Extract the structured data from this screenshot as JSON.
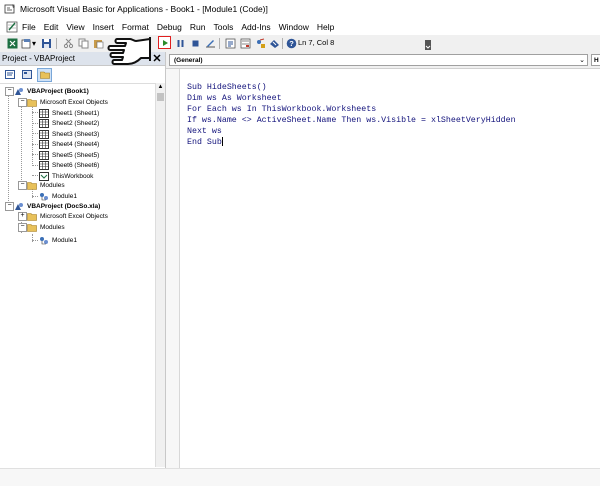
{
  "window": {
    "title": "Microsoft Visual Basic for Applications - Book1 - [Module1 (Code)]"
  },
  "menu": [
    "File",
    "Edit",
    "View",
    "Insert",
    "Format",
    "Debug",
    "Run",
    "Tools",
    "Add-Ins",
    "Window",
    "Help"
  ],
  "toolbar": {
    "status": "Ln 7, Col 8"
  },
  "project_panel": {
    "title": "Project - VBAProject",
    "close": "✕",
    "tree": [
      {
        "label": "VBAProject (Book1)",
        "bold": true,
        "icon": "vbaproject-icon"
      },
      {
        "label": "Microsoft Excel Objects",
        "icon": "folder-icon"
      },
      {
        "label": "Sheet1 (Sheet1)",
        "icon": "sheet-icon"
      },
      {
        "label": "Sheet2 (Sheet2)",
        "icon": "sheet-icon"
      },
      {
        "label": "Sheet3 (Sheet3)",
        "icon": "sheet-icon"
      },
      {
        "label": "Sheet4 (Sheet4)",
        "icon": "sheet-icon"
      },
      {
        "label": "Sheet5 (Sheet5)",
        "icon": "sheet-icon"
      },
      {
        "label": "Sheet6 (Sheet6)",
        "icon": "sheet-icon"
      },
      {
        "label": "ThisWorkbook",
        "icon": "workbook-icon"
      },
      {
        "label": "Modules",
        "icon": "folder-icon"
      },
      {
        "label": "Module1",
        "icon": "module-icon"
      },
      {
        "label": "VBAProject (DocSo.xla)",
        "bold": true,
        "icon": "vbaproject-icon"
      },
      {
        "label": "Microsoft Excel Objects",
        "icon": "folder-icon"
      },
      {
        "label": "Modules",
        "icon": "folder-icon"
      },
      {
        "label": "Module1",
        "icon": "module-icon"
      }
    ]
  },
  "code_window": {
    "object_combo": "(General)",
    "proc_combo": "H",
    "lines": [
      "Sub HideSheets()",
      "Dim ws As Worksheet",
      "For Each ws In ThisWorkbook.Worksheets",
      "If ws.Name <> ActiveSheet.Name Then ws.Visible = xlSheetVeryHidden",
      "Next ws",
      "End Sub"
    ]
  },
  "colors": {
    "code_text": "#13137c",
    "highlight": "#e02020",
    "panel_header": "#dde3ec"
  }
}
